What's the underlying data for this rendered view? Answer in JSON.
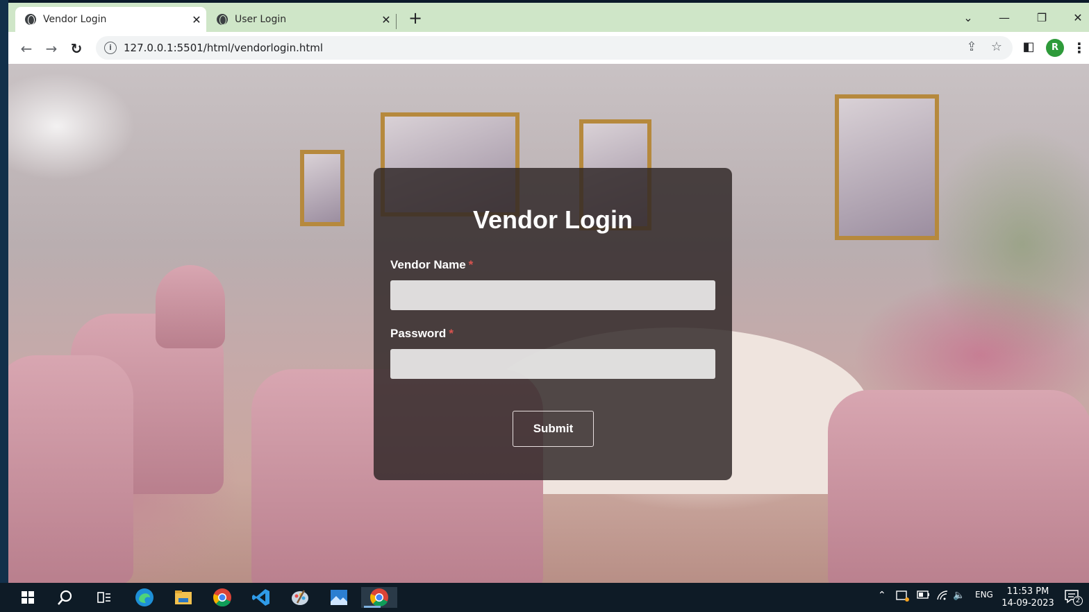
{
  "browser": {
    "tabs": [
      {
        "title": "Vendor Login",
        "active": true
      },
      {
        "title": "User Login",
        "active": false
      }
    ],
    "url": "127.0.0.1:5501/html/vendorlogin.html",
    "profile_initial": "R"
  },
  "login": {
    "title": "Vendor Login",
    "vendor_name_label": "Vendor Name",
    "password_label": "Password",
    "required_marker": "*",
    "submit_label": "Submit"
  },
  "taskbar": {
    "language": "ENG",
    "time": "11:53 PM",
    "date": "14-09-2023",
    "notification_count": "2"
  }
}
